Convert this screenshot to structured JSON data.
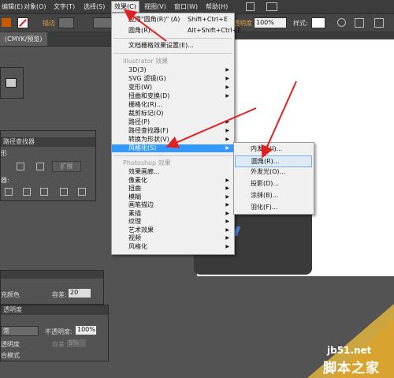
{
  "menubar": {
    "items": [
      "编辑(E)",
      "对象(O)",
      "文字(T)",
      "选择(S)",
      "效果(C)",
      "视图(V)",
      "窗口(W)",
      "帮助(H)"
    ]
  },
  "controlbar": {
    "stroke_label": "描边",
    "opacity_label": "透明度",
    "opacity_value": "100%",
    "style_label": "样式:"
  },
  "document": {
    "tab": "(CMYK/预览)"
  },
  "effects_menu": {
    "apply_last": {
      "label": "应用\"圆角(R)\" (A)",
      "shortcut": "Shift+Ctrl+E"
    },
    "last_effect": {
      "label": "圆角(R)...",
      "shortcut": "Alt+Shift+Ctrl+E"
    },
    "raster_settings": "文档栅格效果设置(E)...",
    "illustrator_section": "Illustrator 效果",
    "illustrator_items": [
      "3D(3)",
      "SVG 滤镜(G)",
      "变形(W)",
      "扭曲和变换(D)",
      "栅格化(R)...",
      "裁剪标记(O)",
      "路径(P)",
      "路径查找器(F)",
      "转换为形状(V)",
      "风格化(S)"
    ],
    "photoshop_section": "Photoshop 效果",
    "photoshop_items": [
      "效果画廊...",
      "像素化",
      "扭曲",
      "模糊",
      "画笔描边",
      "素描",
      "纹理",
      "艺术效果",
      "视频",
      "风格化"
    ]
  },
  "stylize_submenu": {
    "items": [
      "内发光(I)...",
      "圆角(R)...",
      "外发光(O)...",
      "投影(D)...",
      "涂抹(B)...",
      "羽化(F)..."
    ],
    "highlighted": "圆角(R)..."
  },
  "pathfinder_panel": {
    "title": "路径查找器",
    "expand_button": "扩展",
    "shape_label": "形",
    "finder_label": "器:"
  },
  "appearance_panel": {
    "fill_label": "充颜色",
    "opacity_label": "容差:",
    "opacity_value": "20"
  },
  "transparency_panel": {
    "title": "透明度",
    "mode": "常",
    "opacity_label": "不透明度:",
    "opacity_value": "100%",
    "item1": "透明度",
    "item2": "合模式",
    "tolerance_label": "容差:",
    "tolerance_value": "5%"
  },
  "watermark": {
    "site": "jb51.net",
    "name": "脚本之家"
  },
  "colors": {
    "highlight": "#3399ff",
    "arrow": "#e02020",
    "menu_bg": "#f0f0f0",
    "ui_dark": "#3c3c3c"
  }
}
